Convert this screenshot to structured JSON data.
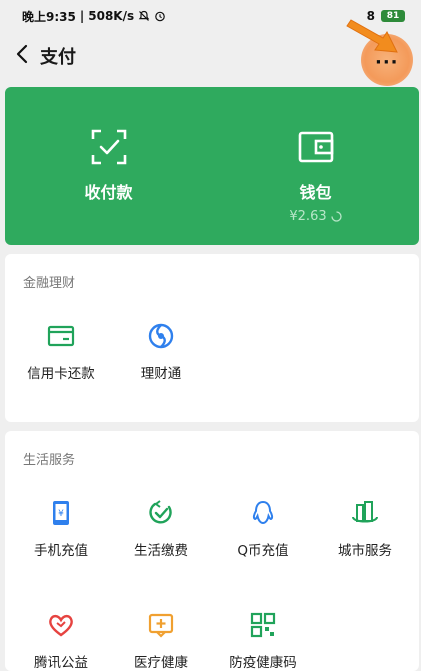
{
  "status_bar": {
    "time": "晚上9:35",
    "speed": "508K/s",
    "signal": "8",
    "battery": "81"
  },
  "nav": {
    "title": "支付"
  },
  "hero": {
    "left_label": "收付款",
    "right_label": "钱包",
    "balance": "¥2.63"
  },
  "finance": {
    "title": "金融理财",
    "items": [
      {
        "label": "信用卡还款",
        "icon": "credit-card-icon"
      },
      {
        "label": "理财通",
        "icon": "licaitong-icon"
      }
    ]
  },
  "life": {
    "title": "生活服务",
    "items": [
      {
        "label": "手机充值",
        "icon": "phone-recharge-icon"
      },
      {
        "label": "生活缴费",
        "icon": "utility-payment-icon"
      },
      {
        "label": "Q币充值",
        "icon": "qq-coin-icon"
      },
      {
        "label": "城市服务",
        "icon": "city-service-icon"
      },
      {
        "label": "腾讯公益",
        "icon": "charity-heart-icon"
      },
      {
        "label": "医疗健康",
        "icon": "medical-health-icon"
      },
      {
        "label": "防疫健康码",
        "icon": "health-code-icon"
      }
    ]
  },
  "colors": {
    "brand_green": "#2faa5e",
    "icon_green": "#20a35a",
    "icon_blue": "#2f80ed",
    "icon_red": "#e64340",
    "icon_orange": "#f0a030"
  }
}
